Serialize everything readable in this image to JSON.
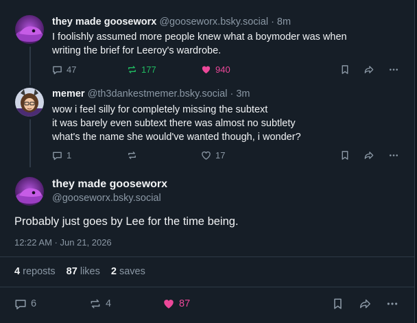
{
  "posts": [
    {
      "author": "they made gooseworx",
      "handle": "@gooseworx.bsky.social",
      "time": "· 8m",
      "lines": [
        "I foolishly assumed more people knew what a boymoder was when",
        "writing the brief for Leeroy's wardrobe."
      ],
      "replies": "47",
      "reposts": "177",
      "likes": "940",
      "repost_color": "#20bc62",
      "like_color": "#ec4899"
    },
    {
      "author": "memer",
      "handle": "@th3dankestmemer.bsky.social",
      "time": "· 3m",
      "lines": [
        "wow i feel silly for completely missing the subtext",
        "it was barely even subtext there was almost no subtlety",
        "what's the name she would've wanted though, i wonder?"
      ],
      "replies": "1",
      "reposts": "",
      "likes": "17"
    }
  ],
  "main_post": {
    "author": "they made gooseworx",
    "handle": "@gooseworx.bsky.social",
    "text": "Probably just goes by Lee for the time being.",
    "timestamp": "12:22 AM · Jun 21, 2026",
    "stats": {
      "reposts_count": "4",
      "reposts_label": "reposts",
      "likes_count": "87",
      "likes_label": "likes",
      "saves_count": "2",
      "saves_label": "saves"
    },
    "actions": {
      "replies": "6",
      "reposts": "4",
      "likes": "87"
    }
  },
  "colors": {
    "background": "#161e27",
    "muted": "#8b98a5",
    "like": "#ec4899",
    "repost": "#20bc62"
  }
}
